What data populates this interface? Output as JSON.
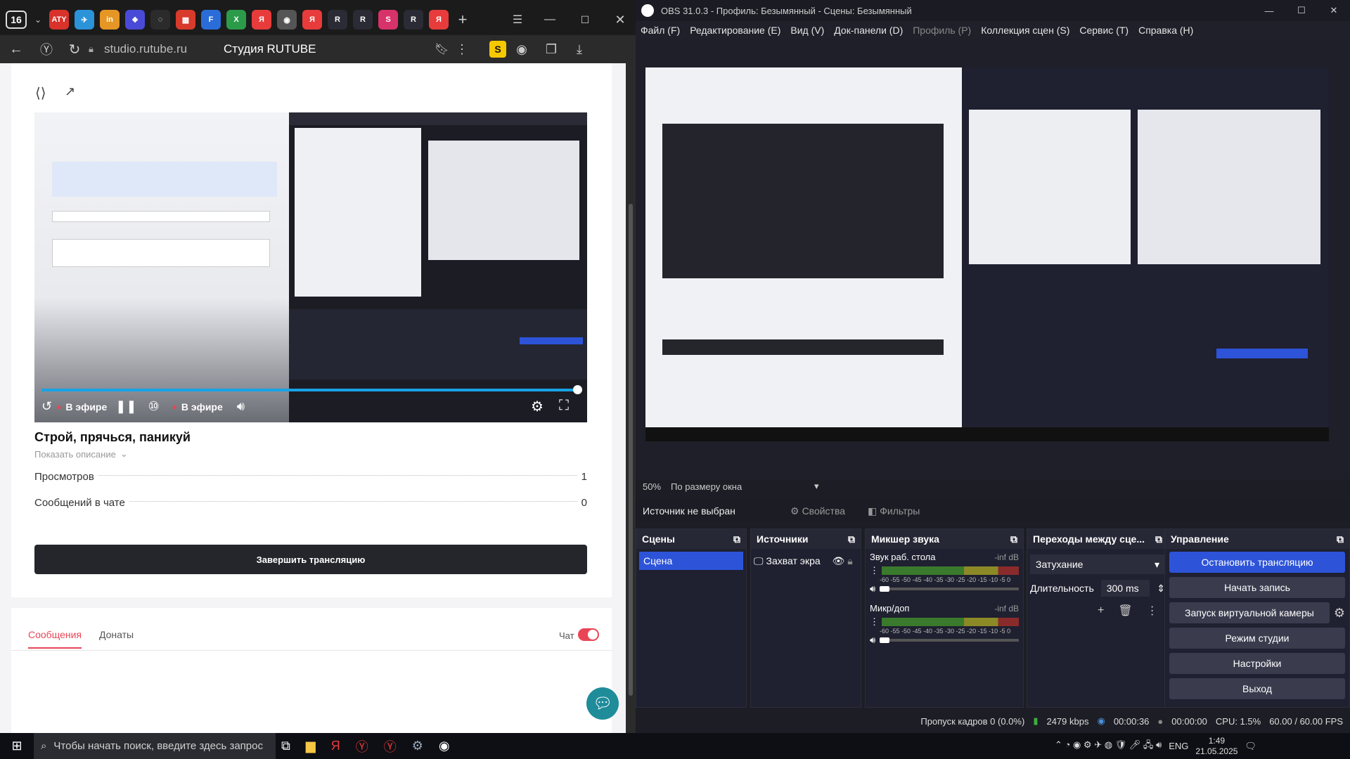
{
  "browser": {
    "tab_count_badge": "16",
    "tabs": [
      {
        "label": "ATY",
        "color": "#d8322a"
      },
      {
        "label": "✈",
        "color": "#2b93d8"
      },
      {
        "label": "in",
        "color": "#e69624"
      },
      {
        "label": "❖",
        "color": "#4a4ad8"
      },
      {
        "label": "◌",
        "color": "#2b2b2b"
      },
      {
        "label": "▦",
        "color": "#d83a2b"
      },
      {
        "label": "F",
        "color": "#2b6dd8"
      },
      {
        "label": "X",
        "color": "#2b9b4a"
      },
      {
        "label": "Я",
        "color": "#e83b3b"
      },
      {
        "label": "◉",
        "color": "#555"
      },
      {
        "label": "Я",
        "color": "#e83b3b"
      },
      {
        "label": "R",
        "color": "#2b2b35"
      },
      {
        "label": "R",
        "color": "#2b2b35"
      },
      {
        "label": "S",
        "color": "#d8326a"
      },
      {
        "label": "R",
        "color": "#2b2b35"
      },
      {
        "label": "Я",
        "color": "#e83b3b"
      }
    ],
    "address": "studio.rutube.ru",
    "page_title": "Студия RUTUBE"
  },
  "page": {
    "player_live_left": "В эфире",
    "player_live_right": "В эфире",
    "stream_title": "Строй, прячься, паникуй",
    "show_description": "Показать описание",
    "views_label": "Просмотров",
    "views_value": "1",
    "chat_msgs_label": "Сообщений в чате",
    "chat_msgs_value": "0",
    "end_stream_button": "Завершить трансляцию",
    "tab_messages": "Сообщения",
    "tab_donations": "Донаты",
    "chat_toggle_label": "Чат",
    "progress_fraction": 0.99
  },
  "obs": {
    "title": "OBS 31.0.3 - Профиль: Безымянный - Сцены: Безымянный",
    "menu": [
      "Файл (F)",
      "Редактирование (E)",
      "Вид (V)",
      "Док-панели (D)",
      "Профиль (P)",
      "Коллекция сцен (S)",
      "Сервис (T)",
      "Справка (H)"
    ],
    "zoom_percent": "50%",
    "zoom_mode": "По размеру окна",
    "no_source": "Источник не выбран",
    "properties_btn": "Свойства",
    "filters_btn": "Фильтры",
    "scenes": {
      "title": "Сцены",
      "items": [
        "Сцена"
      ]
    },
    "sources": {
      "title": "Источники",
      "items": [
        "Захват экра"
      ]
    },
    "mixer": {
      "title": "Микшер звука",
      "channels": [
        {
          "name": "Звук раб. стола",
          "level": "-inf dB"
        },
        {
          "name": "Микр/доп",
          "level": "-inf dB"
        }
      ],
      "scale": "-60 -55 -50 -45 -40 -35 -30 -25 -20 -15 -10 -5 0"
    },
    "transitions": {
      "title": "Переходы между сце...",
      "mode": "Затухание",
      "duration_label": "Длительность",
      "duration_value": "300 ms"
    },
    "controls": {
      "title": "Управление",
      "stop_stream": "Остановить трансляцию",
      "start_record": "Начать запись",
      "virtual_cam": "Запуск виртуальной камеры",
      "studio_mode": "Режим студии",
      "settings": "Настройки",
      "exit": "Выход"
    },
    "status": {
      "dropped": "Пропуск кадров 0 (0.0%)",
      "bitrate": "2479 kbps",
      "stream_time": "00:00:36",
      "rec_time": "00:00:00",
      "cpu": "CPU: 1.5%",
      "fps": "60.00 / 60.00 FPS"
    }
  },
  "taskbar": {
    "search_placeholder": "Чтобы начать поиск, введите здесь запрос",
    "lang": "ENG",
    "time": "1:49",
    "date": "21.05.2025"
  },
  "colors": {
    "accent_obs": "#2d54d8",
    "rutube_dark": "#25262c",
    "rutube_red": "#ea4556"
  }
}
